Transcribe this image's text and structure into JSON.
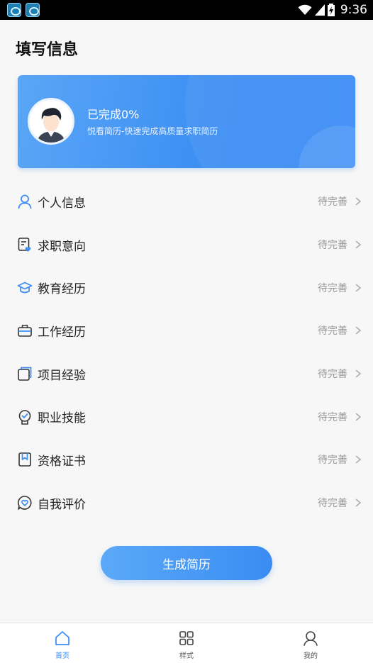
{
  "status_bar": {
    "time": "9:36",
    "icons": [
      "app-notification-icon",
      "app-notification-icon",
      "wifi-icon",
      "signal-icon",
      "battery-charging-icon"
    ]
  },
  "header": {
    "title": "填写信息"
  },
  "banner": {
    "completion_text": "已完成0%",
    "completion_percent": 0,
    "subtitle": "悦看简历-快速完成高质量求职简历",
    "avatar_icon": "user-avatar-icon"
  },
  "sections": [
    {
      "label": "个人信息",
      "status": "待完善",
      "icon": "person-icon"
    },
    {
      "label": "求职意向",
      "status": "待完善",
      "icon": "job-intent-icon"
    },
    {
      "label": "教育经历",
      "status": "待完善",
      "icon": "graduation-cap-icon"
    },
    {
      "label": "工作经历",
      "status": "待完善",
      "icon": "briefcase-icon"
    },
    {
      "label": "项目经验",
      "status": "待完善",
      "icon": "project-icon"
    },
    {
      "label": "职业技能",
      "status": "待完善",
      "icon": "skill-badge-icon"
    },
    {
      "label": "资格证书",
      "status": "待完善",
      "icon": "certificate-icon"
    },
    {
      "label": "自我评价",
      "status": "待完善",
      "icon": "heart-chat-icon"
    }
  ],
  "generate_button": {
    "label": "生成简历"
  },
  "tabs": [
    {
      "label": "首页",
      "icon": "home-icon",
      "active": true
    },
    {
      "label": "样式",
      "icon": "grid-icon",
      "active": false
    },
    {
      "label": "我的",
      "icon": "profile-icon",
      "active": false
    }
  ],
  "colors": {
    "accent": "#3b8cf3",
    "status_text": "#999999",
    "background": "#f7f7f7"
  }
}
